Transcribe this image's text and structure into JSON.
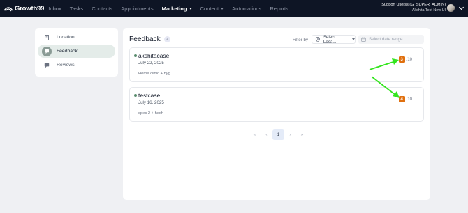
{
  "brand": {
    "name": "Growth99"
  },
  "nav": [
    {
      "label": "Inbox",
      "active": false
    },
    {
      "label": "Tasks",
      "active": false
    },
    {
      "label": "Contacts",
      "active": false
    },
    {
      "label": "Appointments",
      "active": false
    },
    {
      "label": "Marketing",
      "active": true,
      "dropdown": true
    },
    {
      "label": "Content",
      "active": false,
      "dropdown": true
    },
    {
      "label": "Automations",
      "active": false
    },
    {
      "label": "Reports",
      "active": false
    }
  ],
  "user": {
    "name": "Support Userss (G_SUPER_ADMIN)",
    "account": "Akshita Test New UI"
  },
  "sidebar": {
    "items": [
      {
        "label": "Location",
        "icon": "building-icon",
        "active": false
      },
      {
        "label": "Feedback",
        "icon": "feedback-icon",
        "active": true
      },
      {
        "label": "Reviews",
        "icon": "chat-icon",
        "active": false
      }
    ]
  },
  "main": {
    "title": "Feedback",
    "count": "2",
    "filter_label": "Filter by",
    "location_select": "Select Loca...",
    "date_placeholder": "Select date range"
  },
  "feedback": [
    {
      "name": "akshitacase",
      "date": "July 22, 2025",
      "description": "Home clinic + hyg",
      "score": "3",
      "max": "/10"
    },
    {
      "name": "testcase",
      "date": "July 16, 2025",
      "description": "spec 2 + hsxh",
      "score": "4",
      "max": "/10"
    }
  ],
  "pagination": {
    "first": "«",
    "prev": "‹",
    "current": "1",
    "next": "›",
    "last": "»"
  },
  "colors": {
    "nav_bg": "#0e1525",
    "accent": "#5b8d6f",
    "score_badge": "#e0700f",
    "annotation_arrow": "#34e51e"
  }
}
